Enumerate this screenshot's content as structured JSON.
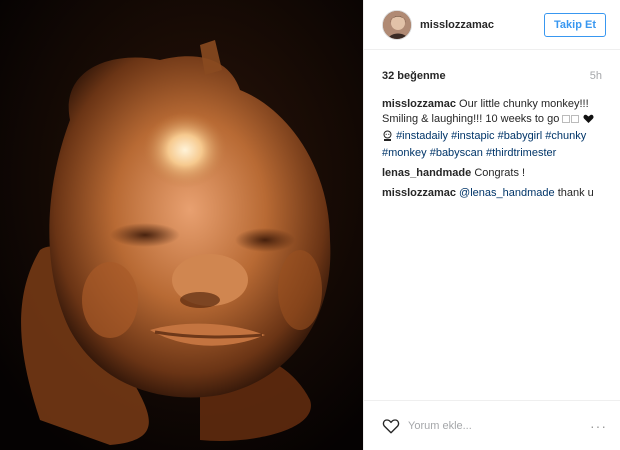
{
  "post": {
    "username": "misslozzamac",
    "follow_label": "Takip Et",
    "likes": "32 beğenme",
    "time": "5h",
    "caption_user": "misslozzamac",
    "caption_text": "Our little chunky monkey!!! Smiling & laughing!!! 10 weeks to go",
    "hashtags": [
      "#instadaily",
      "#instapic",
      "#babygirl",
      "#chunky",
      "#monkey",
      "#babyscan",
      "#thirdtrimester"
    ],
    "comments": [
      {
        "user": "lenas_handmade",
        "text": "Congrats !"
      },
      {
        "user": "misslozzamac",
        "mention": "@lenas_handmade",
        "text": "thank u"
      }
    ],
    "comment_placeholder": "Yorum ekle...",
    "more_label": "···"
  },
  "icons": {
    "like": "heart-icon",
    "options": "more-options-icon",
    "emoji_1": "white-square-emoji",
    "emoji_2": "heart-emoji",
    "emoji_3": "baby-emoji"
  },
  "colors": {
    "link": "#003569",
    "follow": "#3897f0",
    "muted": "#a5a7aa"
  }
}
